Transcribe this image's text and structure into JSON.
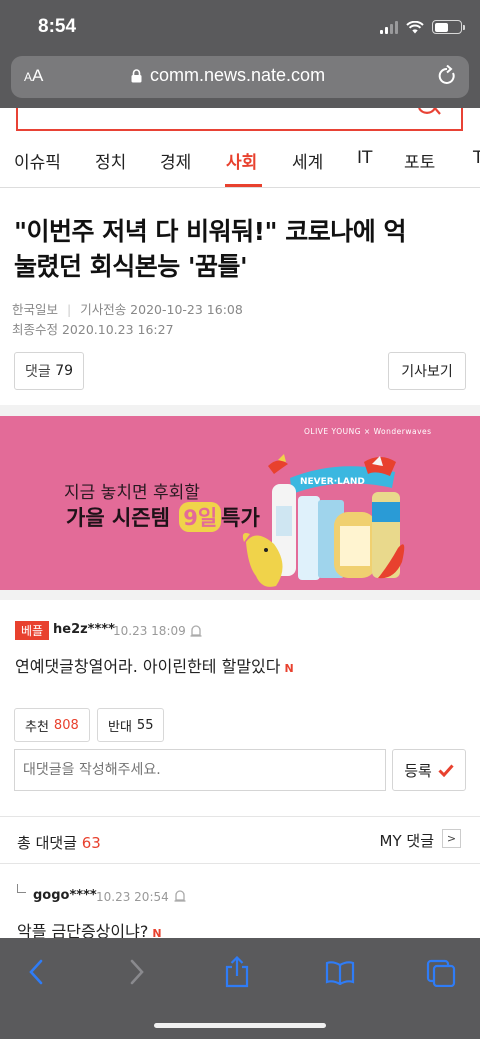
{
  "status": {
    "time": "8:54"
  },
  "browser": {
    "aa_label": "AA",
    "url": "comm.news.nate.com"
  },
  "nav": {
    "items": [
      "이슈픽",
      "정치",
      "경제",
      "사회",
      "세계",
      "IT",
      "포토",
      "T"
    ],
    "active_index": 3
  },
  "article": {
    "title_line1": "\"이번주 저녁 다 비워둬!\" 코로나에 억",
    "title_line2": "눌렸던 회식본능 '꿈틀'",
    "source": "한국일보",
    "sent_label": "기사전송 2020-10-23 16:08",
    "updated": "최종수정 2020.10.23 16:27",
    "comments_label": "댓글",
    "comments_count": "79",
    "view_article": "기사보기"
  },
  "banner": {
    "brand": "OLIVE YOUNG × Wonderwaves",
    "line1": "지금 놓치면 후회할",
    "line2": "가을 시즌템",
    "line2_em": "9일",
    "line2_tail": "특가",
    "sign": "NEVER·LAND"
  },
  "comment": {
    "badge": "베플",
    "username": "he2z****",
    "date": "10.23 18:09",
    "text": "연예댓글창열어라. 아이린한테 할말있다",
    "n_mark": "N",
    "up_label": "추천",
    "up_count": "808",
    "down_label": "반대",
    "down_count": "55",
    "reply_placeholder": "대댓글을 작성해주세요.",
    "submit_label": "등록"
  },
  "replies": {
    "total_label": "총 대댓글",
    "total_count": "63",
    "my_label": "MY 댓글",
    "first": {
      "username": "gogo****",
      "date": "10.23 20:54",
      "text": "악플 금단증상이냐?",
      "n_mark": "N"
    }
  },
  "colors": {
    "accent": "#e8412e",
    "banner": "#e36b98",
    "chrome": "#5a5a5c",
    "ios_blue": "#2f7cf6"
  }
}
